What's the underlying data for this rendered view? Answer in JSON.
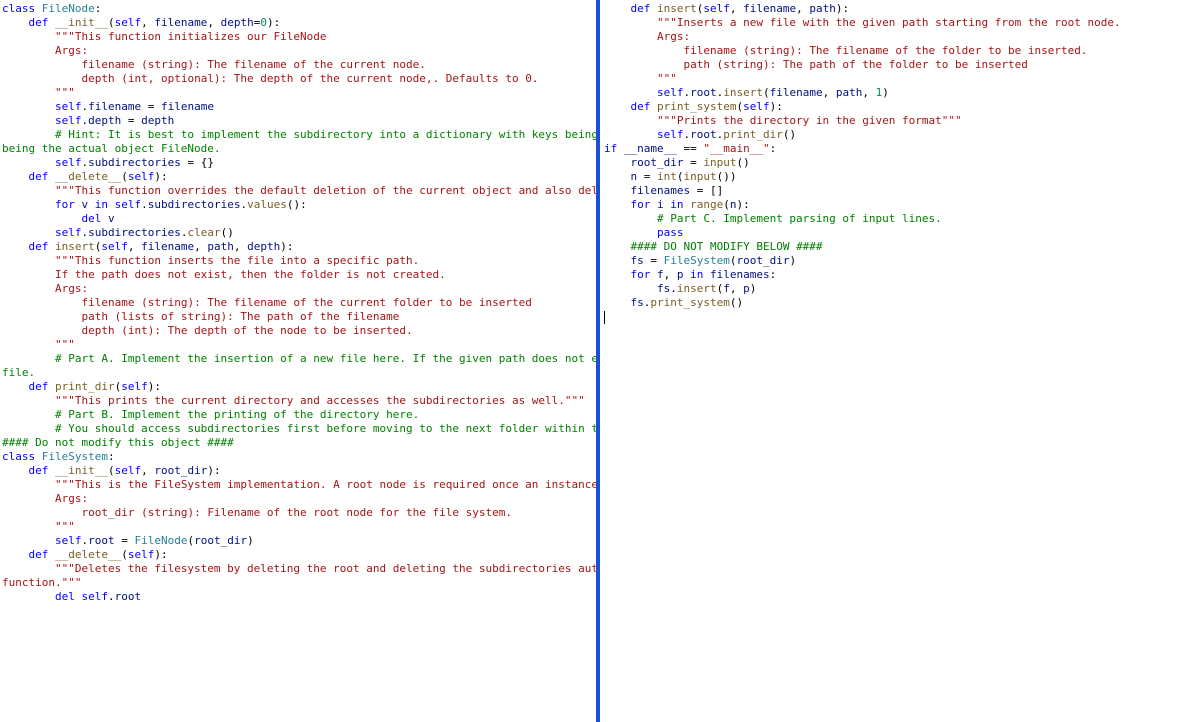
{
  "left_pane": {
    "lines": [
      [
        [
          "kw",
          "class"
        ],
        [
          "pun",
          " "
        ],
        [
          "cls",
          "FileNode"
        ],
        [
          "pun",
          ":"
        ]
      ],
      [
        [
          "pun",
          "    "
        ],
        [
          "kw",
          "def"
        ],
        [
          "pun",
          " "
        ],
        [
          "fn",
          "__init__"
        ],
        [
          "pun",
          "("
        ],
        [
          "self",
          "self"
        ],
        [
          "pun",
          ", "
        ],
        [
          "var",
          "filename"
        ],
        [
          "pun",
          ", "
        ],
        [
          "var",
          "depth"
        ],
        [
          "op",
          "="
        ],
        [
          "num",
          "0"
        ],
        [
          "pun",
          "):"
        ]
      ],
      [
        [
          "pun",
          "        "
        ],
        [
          "str",
          "\"\"\"This function initializes our FileNode"
        ]
      ],
      [
        [
          "pun",
          ""
        ]
      ],
      [
        [
          "pun",
          "        "
        ],
        [
          "str",
          "Args:"
        ]
      ],
      [
        [
          "pun",
          "            "
        ],
        [
          "str",
          "filename (string): The filename of the current node."
        ]
      ],
      [
        [
          "pun",
          "            "
        ],
        [
          "str",
          "depth (int, optional): The depth of the current node,. Defaults to 0."
        ]
      ],
      [
        [
          "pun",
          "        "
        ],
        [
          "str",
          "\"\"\""
        ]
      ],
      [
        [
          "pun",
          "        "
        ],
        [
          "self",
          "self"
        ],
        [
          "pun",
          "."
        ],
        [
          "slf",
          "filename"
        ],
        [
          "pun",
          " = "
        ],
        [
          "var",
          "filename"
        ]
      ],
      [
        [
          "pun",
          "        "
        ],
        [
          "self",
          "self"
        ],
        [
          "pun",
          "."
        ],
        [
          "slf",
          "depth"
        ],
        [
          "pun",
          " = "
        ],
        [
          "var",
          "depth"
        ]
      ],
      [
        [
          "pun",
          "        "
        ],
        [
          "cmt",
          "# Hint: It is best to implement the subdirectory into a dictionary with keys being the filename and the values"
        ]
      ],
      [
        [
          "cmt",
          "being the actual object FileNode."
        ]
      ],
      [
        [
          "pun",
          "        "
        ],
        [
          "self",
          "self"
        ],
        [
          "pun",
          "."
        ],
        [
          "slf",
          "subdirectories"
        ],
        [
          "pun",
          " = {}"
        ]
      ],
      [
        [
          "pun",
          ""
        ]
      ],
      [
        [
          "pun",
          "    "
        ],
        [
          "kw",
          "def"
        ],
        [
          "pun",
          " "
        ],
        [
          "fn",
          "__delete__"
        ],
        [
          "pun",
          "("
        ],
        [
          "self",
          "self"
        ],
        [
          "pun",
          "):"
        ]
      ],
      [
        [
          "pun",
          "        "
        ],
        [
          "str",
          "\"\"\"This function overrides the default deletion of the current object and also deletes the subdirectories\"\"\""
        ]
      ],
      [
        [
          "pun",
          "        "
        ],
        [
          "kw",
          "for"
        ],
        [
          "pun",
          " "
        ],
        [
          "var",
          "v"
        ],
        [
          "pun",
          " "
        ],
        [
          "kw",
          "in"
        ],
        [
          "pun",
          " "
        ],
        [
          "self",
          "self"
        ],
        [
          "pun",
          "."
        ],
        [
          "slf",
          "subdirectories"
        ],
        [
          "pun",
          "."
        ],
        [
          "call",
          "values"
        ],
        [
          "pun",
          "():"
        ]
      ],
      [
        [
          "pun",
          "            "
        ],
        [
          "kw",
          "del"
        ],
        [
          "pun",
          " "
        ],
        [
          "var",
          "v"
        ]
      ],
      [
        [
          "pun",
          "        "
        ],
        [
          "self",
          "self"
        ],
        [
          "pun",
          "."
        ],
        [
          "slf",
          "subdirectories"
        ],
        [
          "pun",
          "."
        ],
        [
          "call",
          "clear"
        ],
        [
          "pun",
          "()"
        ]
      ],
      [
        [
          "pun",
          ""
        ]
      ],
      [
        [
          "pun",
          "    "
        ],
        [
          "kw",
          "def"
        ],
        [
          "pun",
          " "
        ],
        [
          "fn",
          "insert"
        ],
        [
          "pun",
          "("
        ],
        [
          "self",
          "self"
        ],
        [
          "pun",
          ", "
        ],
        [
          "var",
          "filename"
        ],
        [
          "pun",
          ", "
        ],
        [
          "var",
          "path"
        ],
        [
          "pun",
          ", "
        ],
        [
          "var",
          "depth"
        ],
        [
          "pun",
          "):"
        ]
      ],
      [
        [
          "pun",
          "        "
        ],
        [
          "str",
          "\"\"\"This function inserts the file into a specific path."
        ]
      ],
      [
        [
          "pun",
          "        "
        ],
        [
          "str",
          "If the path does not exist, then the folder is not created."
        ]
      ],
      [
        [
          "pun",
          ""
        ]
      ],
      [
        [
          "pun",
          "        "
        ],
        [
          "str",
          "Args:"
        ]
      ],
      [
        [
          "pun",
          "            "
        ],
        [
          "str",
          "filename (string): The filename of the current folder to be inserted"
        ]
      ],
      [
        [
          "pun",
          "            "
        ],
        [
          "str",
          "path (lists of string): The path of the filename"
        ]
      ],
      [
        [
          "pun",
          "            "
        ],
        [
          "str",
          "depth (int): The depth of the node to be inserted."
        ]
      ],
      [
        [
          "pun",
          "        "
        ],
        [
          "str",
          "\"\"\""
        ]
      ],
      [
        [
          "pun",
          "        "
        ],
        [
          "cmt",
          "# Part A. Implement the insertion of a new file here. If the given path does not exist, then you may skip the"
        ]
      ],
      [
        [
          "cmt",
          "file."
        ]
      ],
      [
        [
          "pun",
          ""
        ]
      ],
      [
        [
          "pun",
          "    "
        ],
        [
          "kw",
          "def"
        ],
        [
          "pun",
          " "
        ],
        [
          "fn",
          "print_dir"
        ],
        [
          "pun",
          "("
        ],
        [
          "self",
          "self"
        ],
        [
          "pun",
          "):"
        ]
      ],
      [
        [
          "pun",
          "        "
        ],
        [
          "str",
          "\"\"\"This prints the current directory and accesses the subdirectories as well.\"\"\""
        ]
      ],
      [
        [
          "pun",
          "        "
        ],
        [
          "cmt",
          "# Part B. Implement the printing of the directory here."
        ]
      ],
      [
        [
          "pun",
          "        "
        ],
        [
          "cmt",
          "# You should access subdirectories first before moving to the next folder within the same directory."
        ]
      ],
      [
        [
          "pun",
          ""
        ]
      ],
      [
        [
          "pun",
          ""
        ]
      ],
      [
        [
          "cmt",
          "#### Do not modify this object ####"
        ]
      ],
      [
        [
          "kw",
          "class"
        ],
        [
          "pun",
          " "
        ],
        [
          "cls",
          "FileSystem"
        ],
        [
          "pun",
          ":"
        ]
      ],
      [
        [
          "pun",
          "    "
        ],
        [
          "kw",
          "def"
        ],
        [
          "pun",
          " "
        ],
        [
          "fn",
          "__init__"
        ],
        [
          "pun",
          "("
        ],
        [
          "self",
          "self"
        ],
        [
          "pun",
          ", "
        ],
        [
          "var",
          "root_dir"
        ],
        [
          "pun",
          "):"
        ]
      ],
      [
        [
          "pun",
          "        "
        ],
        [
          "str",
          "\"\"\"This is the FileSystem implementation. A root node is required once an instance is created"
        ]
      ],
      [
        [
          "pun",
          ""
        ]
      ],
      [
        [
          "pun",
          "        "
        ],
        [
          "str",
          "Args:"
        ]
      ],
      [
        [
          "pun",
          "            "
        ],
        [
          "str",
          "root_dir (string): Filename of the root node for the file system."
        ]
      ],
      [
        [
          "pun",
          "        "
        ],
        [
          "str",
          "\"\"\""
        ]
      ],
      [
        [
          "pun",
          "        "
        ],
        [
          "self",
          "self"
        ],
        [
          "pun",
          "."
        ],
        [
          "slf",
          "root"
        ],
        [
          "pun",
          " = "
        ],
        [
          "cls",
          "FileNode"
        ],
        [
          "pun",
          "("
        ],
        [
          "var",
          "root_dir"
        ],
        [
          "pun",
          ")"
        ]
      ],
      [
        [
          "pun",
          ""
        ]
      ],
      [
        [
          "pun",
          "    "
        ],
        [
          "kw",
          "def"
        ],
        [
          "pun",
          " "
        ],
        [
          "fn",
          "__delete__"
        ],
        [
          "pun",
          "("
        ],
        [
          "self",
          "self"
        ],
        [
          "pun",
          "):"
        ]
      ],
      [
        [
          "pun",
          "        "
        ],
        [
          "str",
          "\"\"\"Deletes the filesystem by deleting the root and deleting the subdirectories automatically due to the override"
        ]
      ],
      [
        [
          "str",
          "function.\"\"\""
        ]
      ],
      [
        [
          "pun",
          "        "
        ],
        [
          "kw",
          "del"
        ],
        [
          "pun",
          " "
        ],
        [
          "self",
          "self"
        ],
        [
          "pun",
          "."
        ],
        [
          "slf",
          "root"
        ]
      ]
    ]
  },
  "right_pane": {
    "lines": [
      [
        [
          "pun",
          "    "
        ],
        [
          "kw",
          "def"
        ],
        [
          "pun",
          " "
        ],
        [
          "fn",
          "insert"
        ],
        [
          "pun",
          "("
        ],
        [
          "self",
          "self"
        ],
        [
          "pun",
          ", "
        ],
        [
          "var",
          "filename"
        ],
        [
          "pun",
          ", "
        ],
        [
          "var",
          "path"
        ],
        [
          "pun",
          "):"
        ]
      ],
      [
        [
          "pun",
          "        "
        ],
        [
          "str",
          "\"\"\"Inserts a new file with the given path starting from the root node."
        ]
      ],
      [
        [
          "pun",
          ""
        ]
      ],
      [
        [
          "pun",
          "        "
        ],
        [
          "str",
          "Args:"
        ]
      ],
      [
        [
          "pun",
          "            "
        ],
        [
          "str",
          "filename (string): The filename of the folder to be inserted."
        ]
      ],
      [
        [
          "pun",
          "            "
        ],
        [
          "str",
          "path (string): The path of the folder to be inserted"
        ]
      ],
      [
        [
          "pun",
          "        "
        ],
        [
          "str",
          "\"\"\""
        ]
      ],
      [
        [
          "pun",
          "        "
        ],
        [
          "self",
          "self"
        ],
        [
          "pun",
          "."
        ],
        [
          "slf",
          "root"
        ],
        [
          "pun",
          "."
        ],
        [
          "call",
          "insert"
        ],
        [
          "pun",
          "("
        ],
        [
          "var",
          "filename"
        ],
        [
          "pun",
          ", "
        ],
        [
          "var",
          "path"
        ],
        [
          "pun",
          ", "
        ],
        [
          "num",
          "1"
        ],
        [
          "pun",
          ")"
        ]
      ],
      [
        [
          "pun",
          ""
        ]
      ],
      [
        [
          "pun",
          "    "
        ],
        [
          "kw",
          "def"
        ],
        [
          "pun",
          " "
        ],
        [
          "fn",
          "print_system"
        ],
        [
          "pun",
          "("
        ],
        [
          "self",
          "self"
        ],
        [
          "pun",
          "):"
        ]
      ],
      [
        [
          "pun",
          "        "
        ],
        [
          "str",
          "\"\"\"Prints the directory in the given format\"\"\""
        ]
      ],
      [
        [
          "pun",
          "        "
        ],
        [
          "self",
          "self"
        ],
        [
          "pun",
          "."
        ],
        [
          "slf",
          "root"
        ],
        [
          "pun",
          "."
        ],
        [
          "call",
          "print_dir"
        ],
        [
          "pun",
          "()"
        ]
      ],
      [
        [
          "pun",
          ""
        ]
      ],
      [
        [
          "pun",
          ""
        ]
      ],
      [
        [
          "kw",
          "if"
        ],
        [
          "pun",
          " "
        ],
        [
          "var",
          "__name__"
        ],
        [
          "pun",
          " == "
        ],
        [
          "str",
          "\"__main__\""
        ],
        [
          "pun",
          ":"
        ]
      ],
      [
        [
          "pun",
          "    "
        ],
        [
          "var",
          "root_dir"
        ],
        [
          "pun",
          " = "
        ],
        [
          "call",
          "input"
        ],
        [
          "pun",
          "()"
        ]
      ],
      [
        [
          "pun",
          "    "
        ],
        [
          "var",
          "n"
        ],
        [
          "pun",
          " = "
        ],
        [
          "call",
          "int"
        ],
        [
          "pun",
          "("
        ],
        [
          "call",
          "input"
        ],
        [
          "pun",
          "())"
        ]
      ],
      [
        [
          "pun",
          "    "
        ],
        [
          "var",
          "filenames"
        ],
        [
          "pun",
          " = []"
        ]
      ],
      [
        [
          "pun",
          ""
        ]
      ],
      [
        [
          "pun",
          "    "
        ],
        [
          "kw",
          "for"
        ],
        [
          "pun",
          " "
        ],
        [
          "var",
          "i"
        ],
        [
          "pun",
          " "
        ],
        [
          "kw",
          "in"
        ],
        [
          "pun",
          " "
        ],
        [
          "call",
          "range"
        ],
        [
          "pun",
          "("
        ],
        [
          "var",
          "n"
        ],
        [
          "pun",
          "):"
        ]
      ],
      [
        [
          "pun",
          "        "
        ],
        [
          "cmt",
          "# Part C. Implement parsing of input lines."
        ]
      ],
      [
        [
          "pun",
          "        "
        ],
        [
          "kw",
          "pass"
        ]
      ],
      [
        [
          "pun",
          ""
        ]
      ],
      [
        [
          "pun",
          "    "
        ],
        [
          "cmt",
          "#### DO NOT MODIFY BELOW ####"
        ]
      ],
      [
        [
          "pun",
          "    "
        ],
        [
          "var",
          "fs"
        ],
        [
          "pun",
          " = "
        ],
        [
          "cls",
          "FileSystem"
        ],
        [
          "pun",
          "("
        ],
        [
          "var",
          "root_dir"
        ],
        [
          "pun",
          ")"
        ]
      ],
      [
        [
          "pun",
          "    "
        ],
        [
          "kw",
          "for"
        ],
        [
          "pun",
          " "
        ],
        [
          "var",
          "f"
        ],
        [
          "pun",
          ", "
        ],
        [
          "var",
          "p"
        ],
        [
          "pun",
          " "
        ],
        [
          "kw",
          "in"
        ],
        [
          "pun",
          " "
        ],
        [
          "var",
          "filenames"
        ],
        [
          "pun",
          ":"
        ]
      ],
      [
        [
          "pun",
          "        "
        ],
        [
          "var",
          "fs"
        ],
        [
          "pun",
          "."
        ],
        [
          "call",
          "insert"
        ],
        [
          "pun",
          "("
        ],
        [
          "var",
          "f"
        ],
        [
          "pun",
          ", "
        ],
        [
          "var",
          "p"
        ],
        [
          "pun",
          ")"
        ]
      ],
      [
        [
          "pun",
          ""
        ]
      ],
      [
        [
          "pun",
          "    "
        ],
        [
          "var",
          "fs"
        ],
        [
          "pun",
          "."
        ],
        [
          "call",
          "print_system"
        ],
        [
          "pun",
          "()"
        ]
      ],
      [
        [
          "pun",
          ""
        ]
      ],
      [
        [
          "cursor",
          ""
        ]
      ]
    ]
  }
}
